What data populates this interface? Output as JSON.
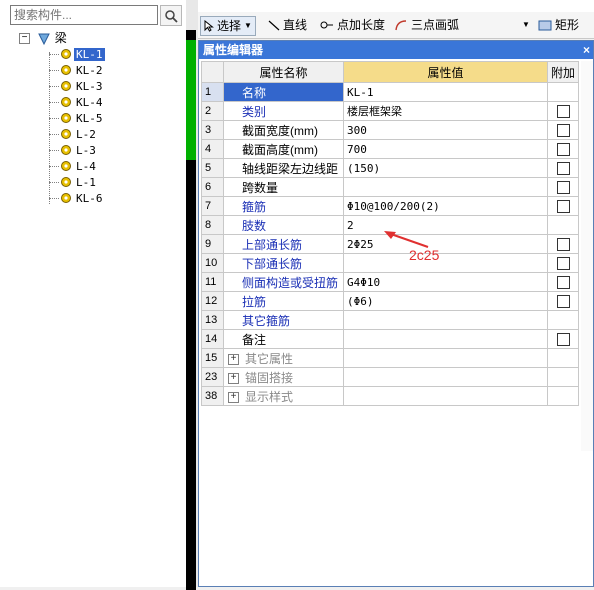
{
  "search": {
    "placeholder": "搜索构件..."
  },
  "tree": {
    "root": "梁",
    "items": [
      "KL-1",
      "KL-2",
      "KL-3",
      "KL-4",
      "KL-5",
      "L-2",
      "L-3",
      "L-4",
      "L-1",
      "KL-6"
    ],
    "selected": "KL-1"
  },
  "toolbar": {
    "select_label": "选择",
    "line_label": "直线",
    "point_length_label": "点加长度",
    "arc_label": "三点画弧",
    "rect_label": "矩形"
  },
  "editor": {
    "title": "属性编辑器",
    "col_name": "属性名称",
    "col_value": "属性值",
    "col_extra": "附加",
    "rows": [
      {
        "num": "1",
        "name": "名称",
        "value": "KL-1",
        "blue": false,
        "check": false,
        "selected": true
      },
      {
        "num": "2",
        "name": "类别",
        "value": "楼层框架梁",
        "blue": true,
        "check": true
      },
      {
        "num": "3",
        "name": "截面宽度(mm)",
        "value": "300",
        "blue": false,
        "check": true
      },
      {
        "num": "4",
        "name": "截面高度(mm)",
        "value": "700",
        "blue": false,
        "check": true
      },
      {
        "num": "5",
        "name": "轴线距梁左边线距",
        "value": "(150)",
        "blue": false,
        "check": true
      },
      {
        "num": "6",
        "name": "跨数量",
        "value": "",
        "blue": false,
        "check": true
      },
      {
        "num": "7",
        "name": "箍筋",
        "value": "Φ10@100/200(2)",
        "blue": true,
        "check": true
      },
      {
        "num": "8",
        "name": "肢数",
        "value": "2",
        "blue": true,
        "check": false
      },
      {
        "num": "9",
        "name": "上部通长筋",
        "value": "2Φ25",
        "blue": true,
        "check": true
      },
      {
        "num": "10",
        "name": "下部通长筋",
        "value": "",
        "blue": true,
        "check": true
      },
      {
        "num": "11",
        "name": "侧面构造或受扭筋",
        "value": "G4Φ10",
        "blue": true,
        "check": true
      },
      {
        "num": "12",
        "name": "拉筋",
        "value": "(Φ6)",
        "blue": true,
        "check": true
      },
      {
        "num": "13",
        "name": "其它箍筋",
        "value": "",
        "blue": true,
        "check": false
      },
      {
        "num": "14",
        "name": "备注",
        "value": "",
        "blue": false,
        "check": true
      }
    ],
    "groups": [
      {
        "num": "15",
        "name": "其它属性"
      },
      {
        "num": "23",
        "name": "锚固搭接"
      },
      {
        "num": "38",
        "name": "显示样式"
      }
    ]
  },
  "annotation": {
    "text": "2c25",
    "color": "#e03030"
  }
}
